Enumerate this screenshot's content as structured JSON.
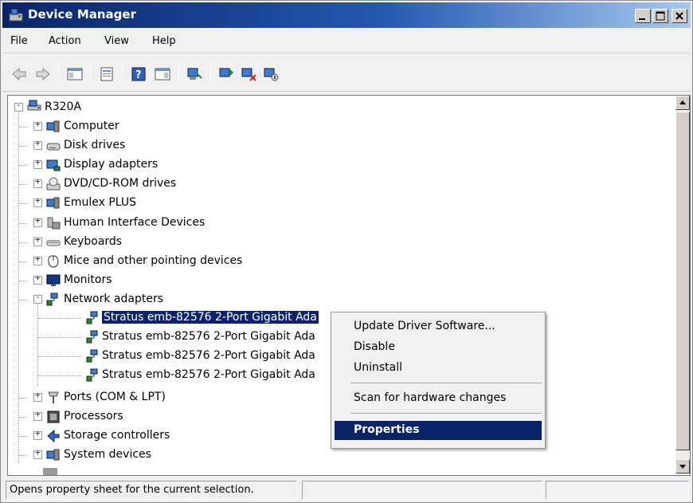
{
  "window": {
    "title": "Device Manager",
    "colors": {
      "title_bar": "#0a246a",
      "selection": "#0a246a",
      "face": "#f0f0f0"
    }
  },
  "menu": [
    "File",
    "Action",
    "View",
    "Help"
  ],
  "toolbar_icons": [
    "back-arrow-icon",
    "forward-arrow-icon",
    "show-hide-tree-icon",
    "properties-icon",
    "help-icon",
    "action-pane-icon",
    "update-driver-icon",
    "scan-hardware-icon",
    "uninstall-icon",
    "disable-icon",
    "enable-icon"
  ],
  "tree": {
    "root": "R320A",
    "categories": [
      {
        "label": "Computer",
        "icon": "computer-icon",
        "expanded": false
      },
      {
        "label": "Disk drives",
        "icon": "disk-drive-icon",
        "expanded": false
      },
      {
        "label": "Display adapters",
        "icon": "display-adapter-icon",
        "expanded": false
      },
      {
        "label": "DVD/CD-ROM drives",
        "icon": "dvd-drive-icon",
        "expanded": false
      },
      {
        "label": "Emulex PLUS",
        "icon": "emulex-icon",
        "expanded": false
      },
      {
        "label": "Human Interface Devices",
        "icon": "hid-icon",
        "expanded": false
      },
      {
        "label": "Keyboards",
        "icon": "keyboard-icon",
        "expanded": false
      },
      {
        "label": "Mice and other pointing devices",
        "icon": "mouse-icon",
        "expanded": false
      },
      {
        "label": "Monitors",
        "icon": "monitor-icon",
        "expanded": false
      },
      {
        "label": "Network adapters",
        "icon": "network-adapter-icon",
        "expanded": true
      }
    ],
    "network_adapters": [
      "Stratus emb-82576 2-Port Gigabit Ada",
      "Stratus emb-82576 2-Port Gigabit Ada",
      "Stratus emb-82576 2-Port Gigabit Ada",
      "Stratus emb-82576 2-Port Gigabit Ada"
    ],
    "categories_after": [
      {
        "label": "Ports (COM & LPT)",
        "icon": "port-icon",
        "expanded": false
      },
      {
        "label": "Processors",
        "icon": "processor-icon",
        "expanded": false
      },
      {
        "label": "Storage controllers",
        "icon": "storage-controller-icon",
        "expanded": false
      },
      {
        "label": "System devices",
        "icon": "system-device-icon",
        "expanded": false
      }
    ]
  },
  "context_menu": {
    "items": [
      "Update Driver Software...",
      "Disable",
      "Uninstall"
    ],
    "scan": "Scan for hardware changes",
    "properties": "Properties"
  },
  "status": {
    "text": "Opens property sheet for the current selection."
  }
}
